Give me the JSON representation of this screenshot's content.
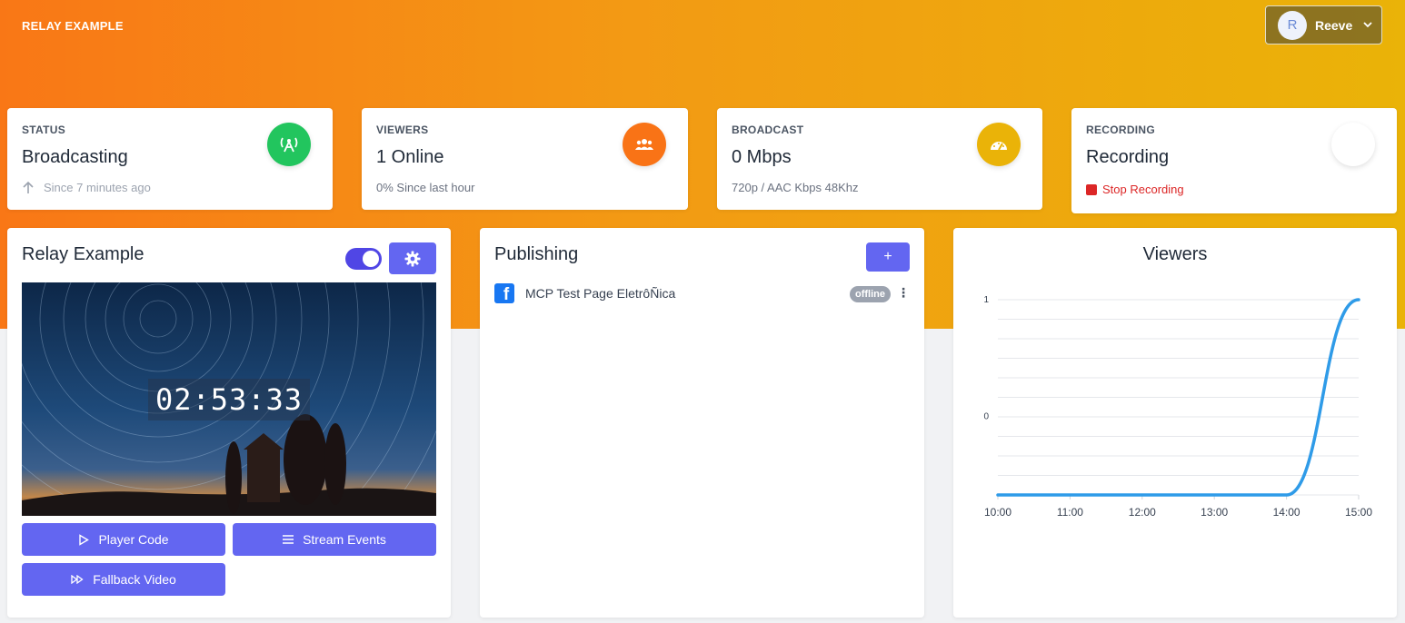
{
  "header": {
    "brand": "RELAY EXAMPLE",
    "user": {
      "initial": "R",
      "name": "Reeve"
    }
  },
  "stats": {
    "status": {
      "label": "STATUS",
      "value": "Broadcasting",
      "sub": "Since 7 minutes ago",
      "icon": "broadcast-tower-icon",
      "color": "#22c55e"
    },
    "viewers": {
      "label": "VIEWERS",
      "value": "1 Online",
      "sub": "0% Since last hour",
      "icon": "users-icon",
      "color": "#f97316"
    },
    "broadcast": {
      "label": "BROADCAST",
      "value": "0 Mbps",
      "sub": "720p / AAC Kbps 48Khz",
      "icon": "speedometer-icon",
      "color": "#eab308"
    },
    "recording": {
      "label": "RECORDING",
      "value": "Recording",
      "sub": "Stop Recording",
      "icon": "recording-indicator-icon",
      "color": "#dc2626"
    }
  },
  "relay": {
    "title": "Relay Example",
    "enabled": true,
    "timecode": "02:53:33",
    "buttons": {
      "player_code": "Player Code",
      "stream_events": "Stream Events",
      "fallback_video": "Fallback Video"
    }
  },
  "publishing": {
    "title": "Publishing",
    "add_label": "+",
    "destinations": [
      {
        "name": "MCP Test Page EletrôÑica",
        "platform": "facebook-icon",
        "status": "offline"
      }
    ]
  },
  "viewers_chart": {
    "title": "Viewers",
    "chart_data": {
      "type": "line",
      "x": [
        "10:00",
        "11:00",
        "12:00",
        "13:00",
        "14:00",
        "15:00"
      ],
      "yticks": [
        1,
        0
      ],
      "series": [
        {
          "values": [
            -0.67,
            -0.67,
            -0.67,
            -0.67,
            -0.67,
            1
          ]
        }
      ],
      "ylim": [
        -0.67,
        1
      ],
      "grid": true,
      "line_color": "#2f9be8"
    }
  },
  "colors": {
    "accent": "#6366f1",
    "toggle": "#5046e5",
    "hero_start": "#f97716",
    "hero_end": "#eab308"
  }
}
